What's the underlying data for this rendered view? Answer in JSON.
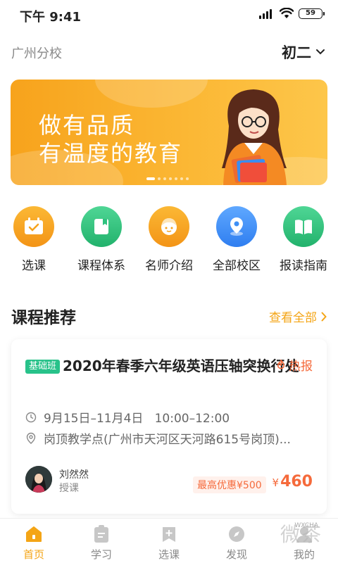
{
  "status_bar": {
    "time": "下午 9:41",
    "battery": "59"
  },
  "header": {
    "campus": "广州分校",
    "grade": "初二"
  },
  "banner": {
    "line1": "做有品质",
    "line2": "有温度的教育",
    "dot_count": 7,
    "active_dot": 0
  },
  "nav": [
    {
      "label": "选课",
      "icon": "calendar-icon",
      "color": "#f7a31c"
    },
    {
      "label": "课程体系",
      "icon": "book-icon",
      "color": "#2ec27e"
    },
    {
      "label": "名师介绍",
      "icon": "teacher-face-icon",
      "color": "#f7a31c"
    },
    {
      "label": "全部校区",
      "icon": "location-pin-icon",
      "color": "#3d8ff5"
    },
    {
      "label": "报读指南",
      "icon": "open-book-icon",
      "color": "#2ec27e"
    }
  ],
  "recommend": {
    "title": "课程推荐",
    "more": "查看全部"
  },
  "course": {
    "tag": "基础班",
    "title": "2020年春季六年级英语压轴突换行处",
    "hot": "热报",
    "time": "9月15日–11月4日   10:00–12:00",
    "location": "岗顶教学点(广州市天河区天河路615号岗顶)...",
    "teacher_name": "刘然然",
    "teacher_role": "授课",
    "discount": "最高优惠¥500",
    "price_symbol": "¥",
    "price": "460"
  },
  "tabs": [
    {
      "label": "首页",
      "icon": "home-icon",
      "active": true
    },
    {
      "label": "学习",
      "icon": "clipboard-icon",
      "active": false
    },
    {
      "label": "选课",
      "icon": "add-course-icon",
      "active": false
    },
    {
      "label": "发现",
      "icon": "discover-icon",
      "active": false
    },
    {
      "label": "我的",
      "icon": "profile-icon",
      "active": false
    }
  ],
  "watermark": {
    "text": "微茶",
    "sub": "WXCHA"
  },
  "colors": {
    "accent": "#f4a516",
    "price": "#f56a3b",
    "tag": "#28c28a"
  }
}
